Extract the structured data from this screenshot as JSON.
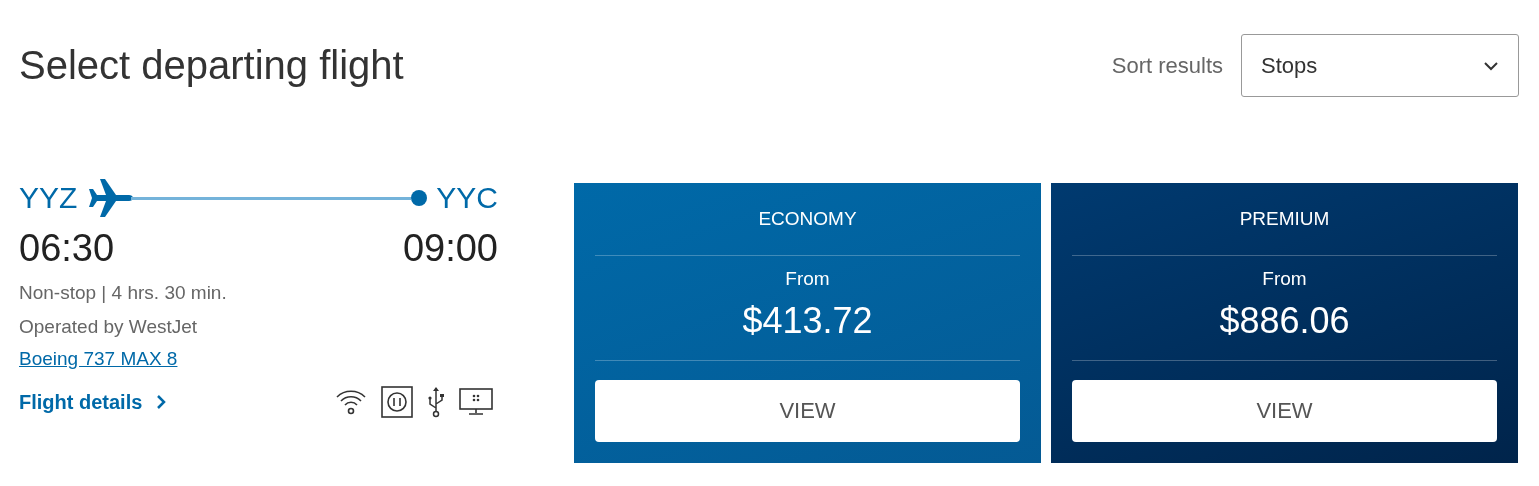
{
  "title": "Select departing flight",
  "sort": {
    "label": "Sort results",
    "value": "Stops"
  },
  "flight": {
    "origin": "YYZ",
    "destination": "YYC",
    "depart": "06:30",
    "arrive": "09:00",
    "summary": "Non-stop | 4 hrs. 30 min.",
    "operator": "Operated by WestJet",
    "aircraft": "Boeing 737 MAX 8",
    "details": "Flight details",
    "amenities": [
      {
        "kind": "wifi"
      },
      {
        "kind": "power"
      },
      {
        "kind": "usb"
      },
      {
        "kind": "screen"
      }
    ]
  },
  "fares": [
    {
      "kind": "economy",
      "cabin": "ECONOMY",
      "from": "From",
      "price": "$413.72",
      "action": "VIEW"
    },
    {
      "kind": "premium",
      "cabin": "PREMIUM",
      "from": "From",
      "price": "$886.06",
      "action": "VIEW"
    }
  ]
}
